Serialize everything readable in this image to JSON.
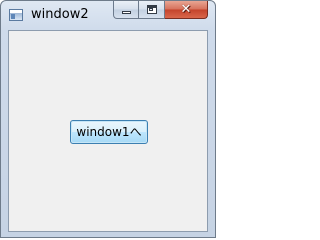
{
  "window": {
    "title": "window2",
    "icon": "app-window-icon",
    "controls": {
      "minimize": "minimize-icon",
      "maximize": "maximize-icon",
      "close": "close-icon",
      "close_glyph": "✕"
    }
  },
  "main": {
    "button_label": "window1へ"
  },
  "colors": {
    "client_background": "#f0f0f0",
    "button_border": "#3c7fb1",
    "close_button": "#c4432b"
  }
}
